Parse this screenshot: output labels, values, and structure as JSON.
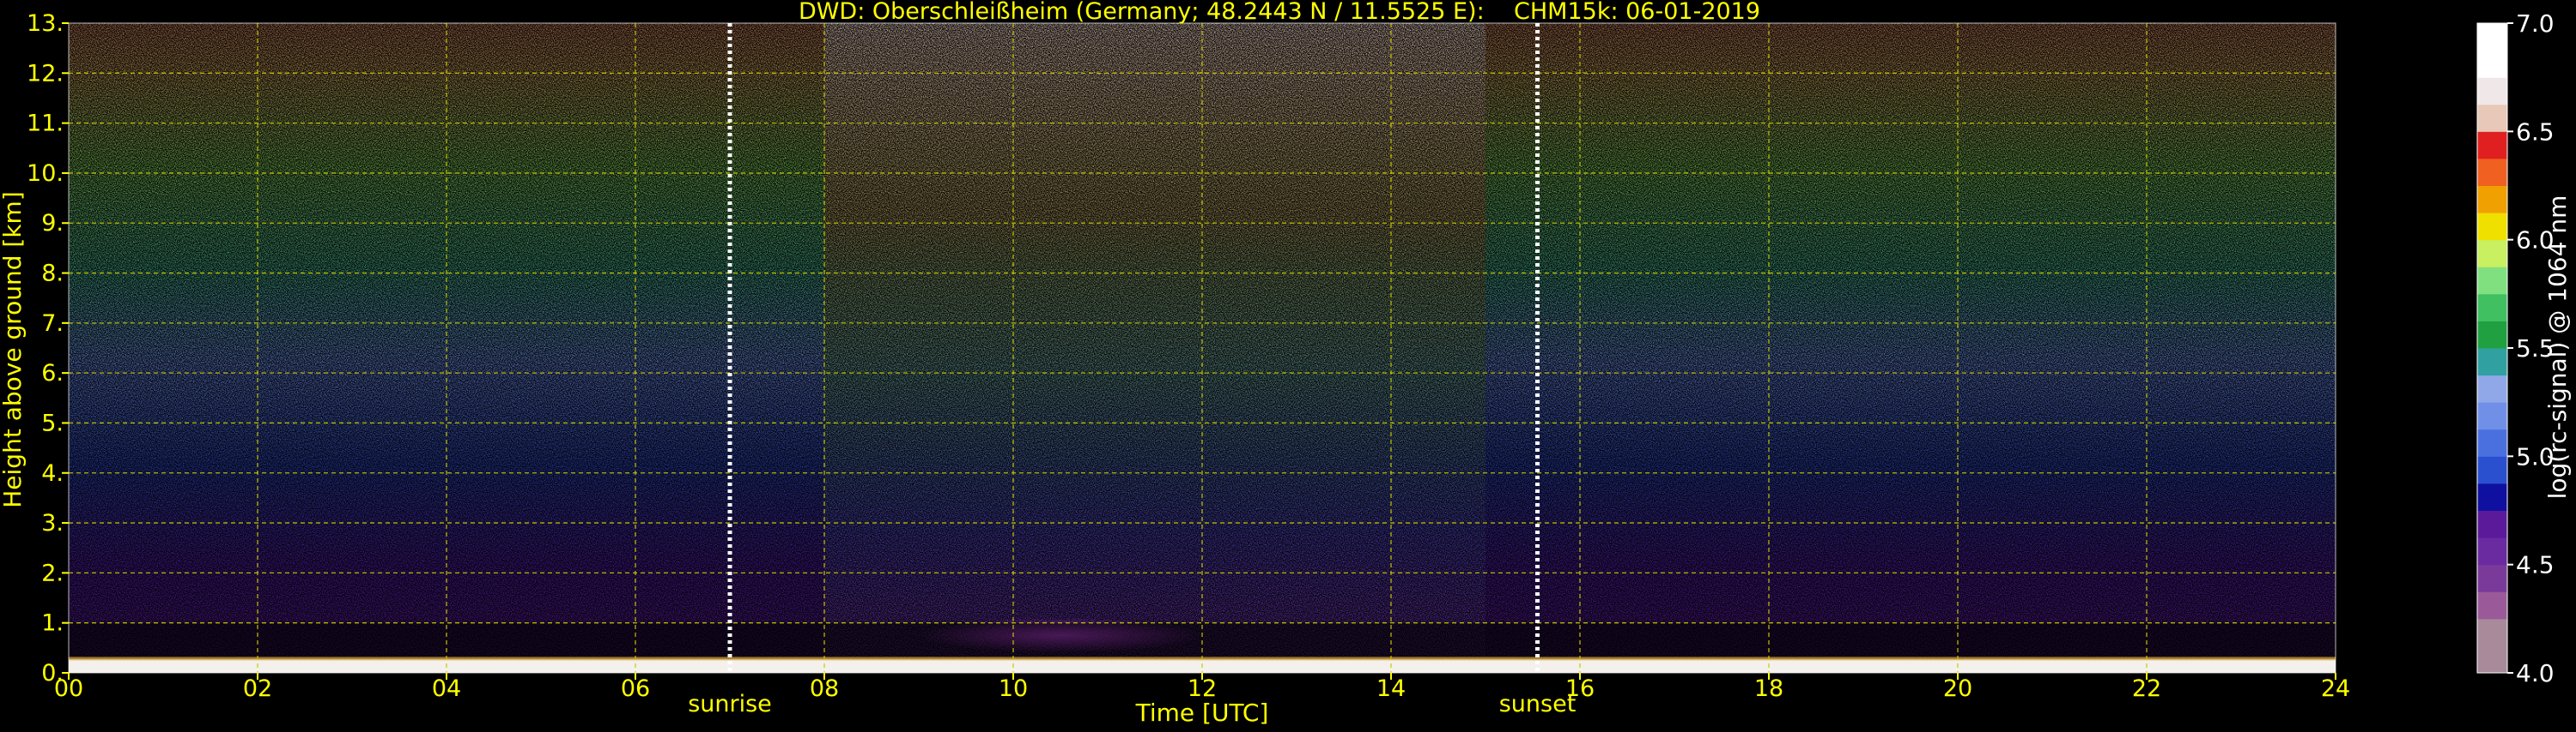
{
  "chart_data": {
    "type": "heatmap",
    "title": "DWD: Oberschleißheim (Germany; 48.2443 N / 11.5525 E):    CHM15k: 06-01-2019",
    "xlabel": "Time [UTC]",
    "ylabel": "Height above ground [km]",
    "xlim": [
      0,
      24
    ],
    "ylim": [
      0,
      13
    ],
    "x_ticks": [
      "00",
      "02",
      "04",
      "06",
      "08",
      "10",
      "12",
      "14",
      "16",
      "18",
      "20",
      "22",
      "24"
    ],
    "y_ticks": [
      "0.",
      "1.",
      "2.",
      "3.",
      "4.",
      "5.",
      "6.",
      "7.",
      "8.",
      "9.",
      "10.",
      "11.",
      "12.",
      "13."
    ],
    "grid": true,
    "grid_style": "dashed",
    "markers": [
      {
        "label": "sunrise",
        "time": 7.0
      },
      {
        "label": "sunset",
        "time": 15.55
      }
    ],
    "colorbar": {
      "label": "log(rc-signal) @ 1064 nm",
      "range": [
        4.0,
        7.0
      ],
      "tick_labels": [
        "4.0",
        "4.5",
        "5.0",
        "5.5",
        "6.0",
        "6.5",
        "7.0"
      ],
      "levels": [
        {
          "from": 4.0,
          "to": 4.25,
          "color": "#a88a9a"
        },
        {
          "from": 4.25,
          "to": 4.375,
          "color": "#9a5a9a"
        },
        {
          "from": 4.375,
          "to": 4.5,
          "color": "#7a3a9a"
        },
        {
          "from": 4.5,
          "to": 4.625,
          "color": "#6a2aa0"
        },
        {
          "from": 4.625,
          "to": 4.75,
          "color": "#5a1a9a"
        },
        {
          "from": 4.75,
          "to": 4.875,
          "color": "#1010a0"
        },
        {
          "from": 4.875,
          "to": 5.0,
          "color": "#2a50d0"
        },
        {
          "from": 5.0,
          "to": 5.125,
          "color": "#4a70e0"
        },
        {
          "from": 5.125,
          "to": 5.25,
          "color": "#7090e8"
        },
        {
          "from": 5.25,
          "to": 5.375,
          "color": "#90a8e8"
        },
        {
          "from": 5.375,
          "to": 5.5,
          "color": "#30a0a0"
        },
        {
          "from": 5.5,
          "to": 5.625,
          "color": "#20a040"
        },
        {
          "from": 5.625,
          "to": 5.75,
          "color": "#40c060"
        },
        {
          "from": 5.75,
          "to": 5.875,
          "color": "#80e080"
        },
        {
          "from": 5.875,
          "to": 6.0,
          "color": "#c8f060"
        },
        {
          "from": 6.0,
          "to": 6.125,
          "color": "#f0e000"
        },
        {
          "from": 6.125,
          "to": 6.25,
          "color": "#f0a000"
        },
        {
          "from": 6.25,
          "to": 6.375,
          "color": "#f06020"
        },
        {
          "from": 6.375,
          "to": 6.5,
          "color": "#e02020"
        },
        {
          "from": 6.5,
          "to": 6.625,
          "color": "#e8c8b8"
        },
        {
          "from": 6.625,
          "to": 6.75,
          "color": "#f0e8e8"
        },
        {
          "from": 6.75,
          "to": 7.0,
          "color": "#ffffff"
        }
      ]
    },
    "colors": {
      "background": "#000000",
      "axis_text": "#ffff00",
      "grid": "#c8c800",
      "marker_line": "#ffffff",
      "colorbar_text": "#ffffff"
    }
  }
}
